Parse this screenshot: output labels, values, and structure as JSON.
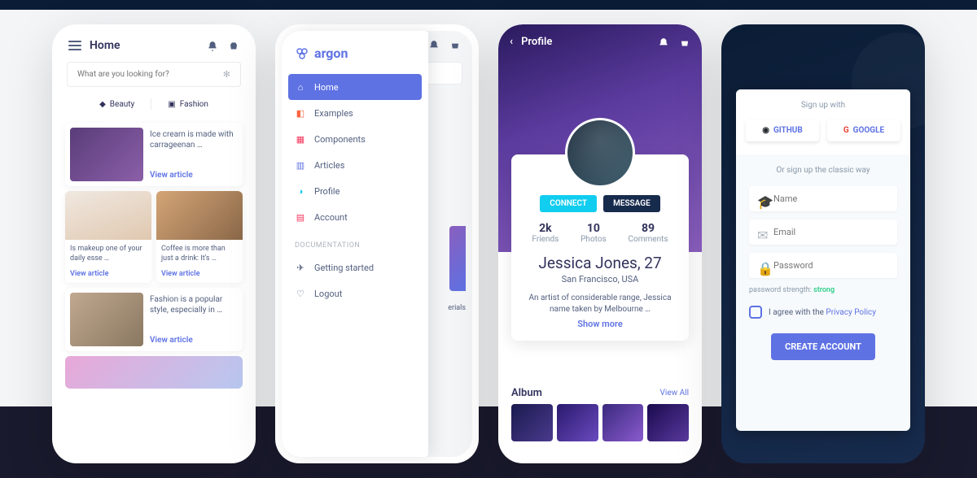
{
  "phone1": {
    "title": "Home",
    "search_placeholder": "What are you looking for?",
    "tabs": {
      "beauty": "Beauty",
      "fashion": "Fashion"
    },
    "cards": {
      "c1": {
        "title": "Ice cream is made with carrageenan …",
        "link": "View article"
      },
      "c2": {
        "title": "Is makeup one of your daily esse …",
        "link": "View article"
      },
      "c3": {
        "title": "Coffee is more than just a drink: It's …",
        "link": "View article"
      },
      "c4": {
        "title": "Fashion is a popular style, especially in …",
        "link": "View article"
      }
    }
  },
  "phone2": {
    "brand": "argon",
    "bg_label": "erials",
    "items": {
      "home": "Home",
      "examples": "Examples",
      "components": "Components",
      "articles": "Articles",
      "profile": "Profile",
      "account": "Account"
    },
    "section": "DOCUMENTATION",
    "doc_items": {
      "start": "Getting started",
      "logout": "Logout"
    }
  },
  "phone3": {
    "title": "Profile",
    "btn_connect": "CONNECT",
    "btn_message": "MESSAGE",
    "stats": {
      "friends_n": "2k",
      "friends_l": "Friends",
      "photos_n": "10",
      "photos_l": "Photos",
      "comments_n": "89",
      "comments_l": "Comments"
    },
    "name": "Jessica Jones, 27",
    "location": "San Francisco, USA",
    "bio": "An artist of considerable range, Jessica name taken by Melbourne …",
    "show_more": "Show more",
    "album_title": "Album",
    "view_all": "View All"
  },
  "phone4": {
    "signup_with": "Sign up with",
    "github": "GITHUB",
    "google": "GOOGLE",
    "or": "Or sign up the classic way",
    "name_ph": "Name",
    "email_ph": "Email",
    "pass_ph": "Password",
    "strength_label": "password strength:",
    "strength_value": "strong",
    "agree_pre": "I agree with the ",
    "privacy": "Privacy Policy",
    "submit": "CREATE ACCOUNT"
  }
}
